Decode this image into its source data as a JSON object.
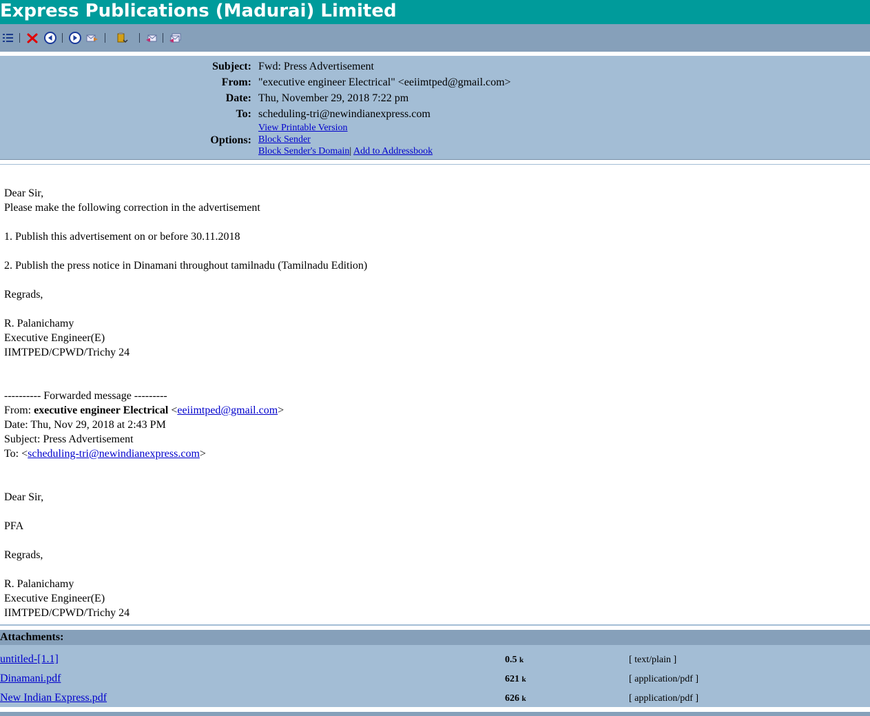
{
  "app": {
    "title": "Express Publications (Madurai) Limited"
  },
  "toolbar": {
    "buttons": [
      "list-icon",
      "delete-icon",
      "previous-icon",
      "next-icon",
      "forward-icon",
      "attach-icon",
      "reply-icon",
      "reply-all-icon"
    ]
  },
  "header": {
    "subject_label": "Subject:",
    "subject": "Fwd: Press Advertisement",
    "from_label": "From:",
    "from": "\"executive engineer Electrical\" <eeiimtped@gmail.com>",
    "date_label": "Date:",
    "date": "Thu, November 29, 2018 7:22 pm",
    "to_label": "To:",
    "to": "scheduling-tri@newindianexpress.com",
    "options_label": "Options:",
    "options": {
      "printable": "View Printable Version",
      "block_sender": "Block Sender",
      "block_domain": "Block Sender's Domain",
      "separator": "|",
      "add_addressbook": "Add to Addressbook"
    }
  },
  "body": {
    "greeting": "Dear Sir,",
    "intro": "Please make the following correction in the advertisement",
    "point1": "1. Publish this advertisement on or before 30.11.2018",
    "point2": "2. Publish the press notice in Dinamani throughout tamilnadu (Tamilnadu Edition)",
    "regards": "Regrads,",
    "sig_name": "R. Palanichamy",
    "sig_title": "Executive Engineer(E)",
    "sig_office": "IIMTPED/CPWD/Trichy 24",
    "fwd_header": "---------- Forwarded message ---------",
    "fwd_from_label": "From: ",
    "fwd_from_name": "executive engineer Electrical",
    "fwd_from_open": " <",
    "fwd_from_email": "eeiimtped@gmail.com",
    "fwd_close": ">",
    "fwd_date": "Date: Thu, Nov 29, 2018 at 2:43 PM",
    "fwd_subject": "Subject: Press Advertisement",
    "fwd_to_label": "To: <",
    "fwd_to_email": "scheduling-tri@newindianexpress.com",
    "greeting2": "Dear Sir,",
    "pfa": "PFA",
    "regards2": "Regrads,",
    "sig2_name": "R. Palanichamy",
    "sig2_title": "Executive Engineer(E)",
    "sig2_office": "IIMTPED/CPWD/Trichy 24"
  },
  "attachments": {
    "title": "Attachments:",
    "unit": "k",
    "items": [
      {
        "name": "untitled-[1.1]",
        "size": "0.5",
        "type": "[ text/plain ]"
      },
      {
        "name": "Dinamani.pdf",
        "size": "621",
        "type": "[ application/pdf ]"
      },
      {
        "name": "New Indian Express.pdf",
        "size": "626",
        "type": "[ application/pdf ]"
      }
    ]
  }
}
